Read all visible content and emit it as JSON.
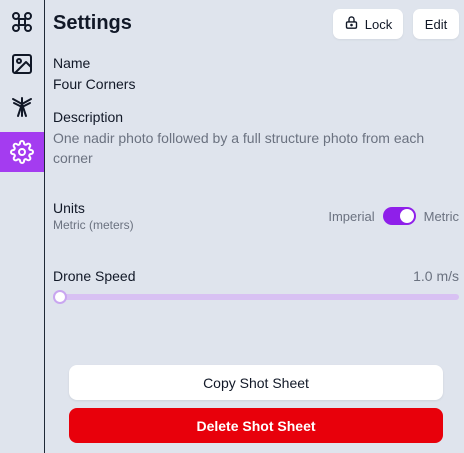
{
  "sidebar": {
    "items": [
      {
        "icon": "drone-icon"
      },
      {
        "icon": "image-icon"
      },
      {
        "icon": "antenna-icon"
      },
      {
        "icon": "gear-icon",
        "active": true
      }
    ]
  },
  "header": {
    "title": "Settings",
    "lock_label": "Lock",
    "edit_label": "Edit"
  },
  "fields": {
    "name_label": "Name",
    "name_value": "Four Corners",
    "description_label": "Description",
    "description_value": "One nadir photo followed by a full structure photo from each corner",
    "units_label": "Units",
    "units_value": "Metric (meters)",
    "units_left": "Imperial",
    "units_right": "Metric",
    "units_metric_on": true,
    "speed_label": "Drone Speed",
    "speed_value": "1.0 m/s",
    "speed_fraction": 0
  },
  "actions": {
    "copy_label": "Copy Shot Sheet",
    "delete_label": "Delete Shot Sheet"
  },
  "colors": {
    "accent": "#a43cf0",
    "toggle_on": "#8f1fea",
    "danger": "#e8000b",
    "background": "#dfe4ed"
  }
}
